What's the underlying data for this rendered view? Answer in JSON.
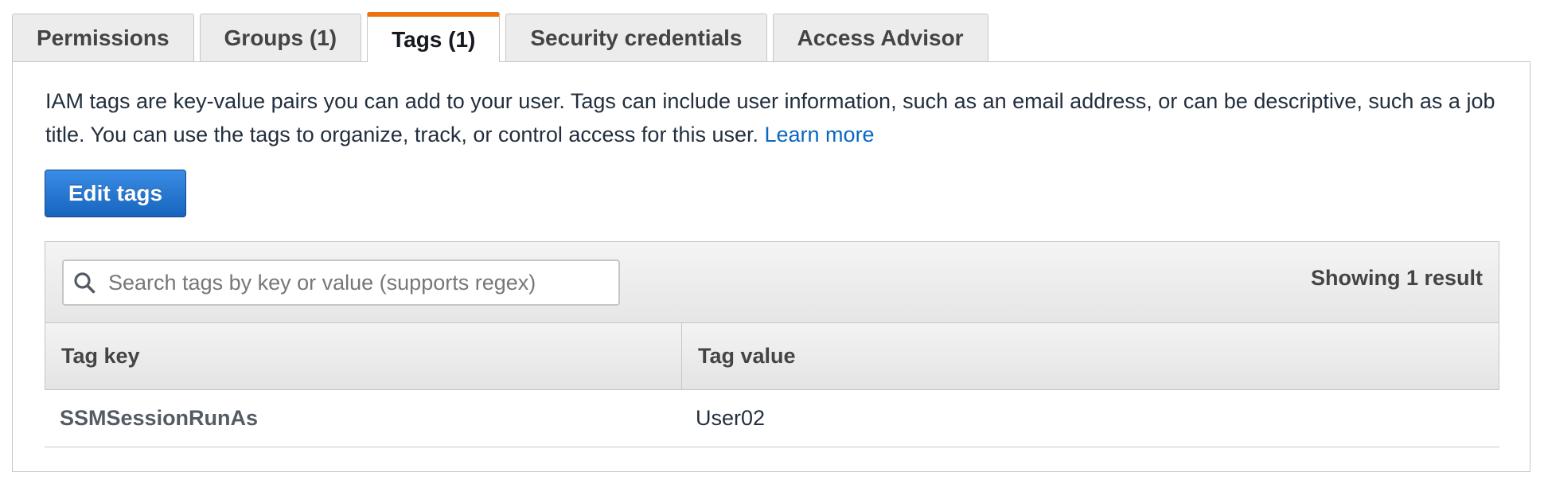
{
  "tabs": [
    {
      "label": "Permissions"
    },
    {
      "label": "Groups (1)"
    },
    {
      "label": "Tags (1)"
    },
    {
      "label": "Security credentials"
    },
    {
      "label": "Access Advisor"
    }
  ],
  "colors": {
    "active_tab_accent": "#ec7211",
    "link": "#0a67c2",
    "primary_button": "#1664be"
  },
  "panel": {
    "description": "IAM tags are key-value pairs you can add to your user. Tags can include user information, such as an email address, or can be descriptive, such as a job title. You can use the tags to organize, track, or control access for this user.",
    "learn_more": "Learn more",
    "edit_button": "Edit tags",
    "search": {
      "placeholder": "Search tags by key or value (supports regex)",
      "value": "",
      "icon": "search-icon"
    },
    "result_count": "Showing 1 result",
    "table": {
      "columns": [
        "Tag key",
        "Tag value"
      ],
      "rows": [
        {
          "key": "SSMSessionRunAs",
          "value": "User02"
        }
      ]
    }
  }
}
